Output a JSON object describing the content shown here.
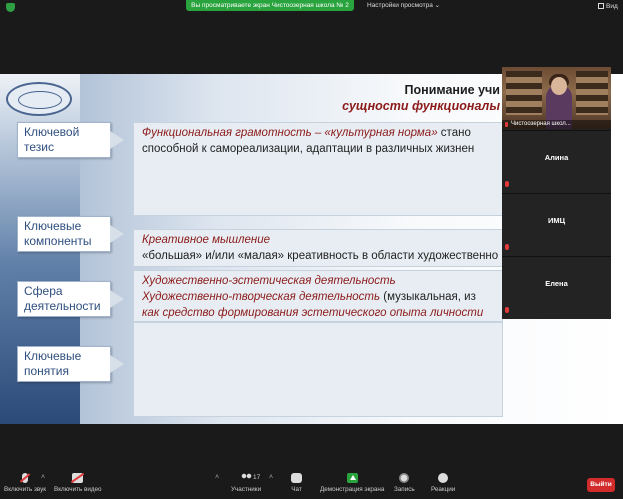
{
  "topbar": {
    "banner": "Вы просматриваете экран Чистоозерная школа № 2",
    "view_options": "Настройки просмотра ⌄",
    "view_button": "Вид"
  },
  "slide": {
    "title_line1": "Понимание учи",
    "title_line2": "сущности функционалы",
    "rows": [
      {
        "label": "Ключевой тезис",
        "line1_red": "Функциональная грамотность – «культурная норма»",
        "line1_rest": " стано",
        "line2": "способной к самореализации, адаптации в различных жизнен"
      },
      {
        "label": "Ключевые компоненты",
        "line1_red": "Креативное мышление",
        "line1_rest": "",
        "line2": "«большая» и/или «малая» креативность в области художественно"
      },
      {
        "label": "Сфера деятельности",
        "line1_red": "Художественно-эстетическая деятельность",
        "line2_red": "Художественно-творческая деятельность",
        "line2_rest": " (музыкальная, из",
        "line3": "как средство формирования эстетического опыта личности"
      },
      {
        "label": "Ключевые понятия"
      }
    ]
  },
  "participants": {
    "video_name": "Чистоозерная школ...",
    "tiles": [
      "Алина",
      "ИМЦ",
      "Елена"
    ]
  },
  "toolbar": {
    "mute": "Включить звук",
    "video": "Включить видео",
    "participants": "Участники",
    "participants_count": "17",
    "chat": "Чат",
    "share": "Демонстрация экрана",
    "record": "Запись",
    "reactions": "Реакции",
    "leave": "Выйти"
  }
}
